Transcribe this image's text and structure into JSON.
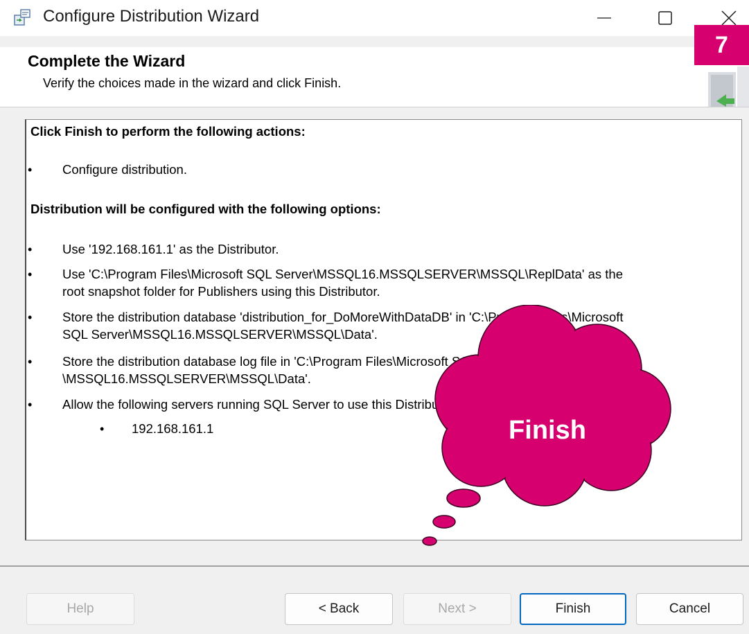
{
  "window": {
    "title": "Configure Distribution Wizard",
    "icon": "wizard-icon",
    "controls": [
      "minimize-icon",
      "maximize-icon",
      "close-icon"
    ]
  },
  "step_badge": "7",
  "header": {
    "title": "Complete the Wizard",
    "subtitle": "Verify the choices made in the wizard and click Finish."
  },
  "summary": {
    "actions_heading": "Click Finish to perform the following actions:",
    "actions": [
      "Configure distribution."
    ],
    "options_heading": "Distribution will be configured with the following options:",
    "options": [
      {
        "lines": [
          "Use '192.168.161.1' as the Distributor."
        ]
      },
      {
        "lines": [
          "Use 'C:\\Program Files\\Microsoft SQL Server\\MSSQL16.MSSQLSERVER\\MSSQL\\ReplData' as the",
          "root snapshot folder for Publishers using this Distributor."
        ]
      },
      {
        "lines": [
          "Store the distribution database 'distribution_for_DoMoreWithDataDB' in 'C:\\Program Files\\Microsoft",
          "SQL Server\\MSSQL16.MSSQLSERVER\\MSSQL\\Data'."
        ]
      },
      {
        "lines": [
          "Store the distribution database log file in 'C:\\Program Files\\Microsoft SQL Server",
          "\\MSSQL16.MSSQLSERVER\\MSSQL\\Data'."
        ]
      },
      {
        "lines": [
          "Allow the following servers running SQL Server to use this Distributor:"
        ]
      }
    ],
    "servers": [
      "192.168.161.1"
    ]
  },
  "callout": {
    "text": "Finish",
    "color": "#d6006f"
  },
  "buttons": {
    "help": "Help",
    "back": "< Back",
    "next": "Next >",
    "finish": "Finish",
    "cancel": "Cancel"
  },
  "colors": {
    "accent": "#0067c0",
    "highlight": "#d6006f"
  }
}
